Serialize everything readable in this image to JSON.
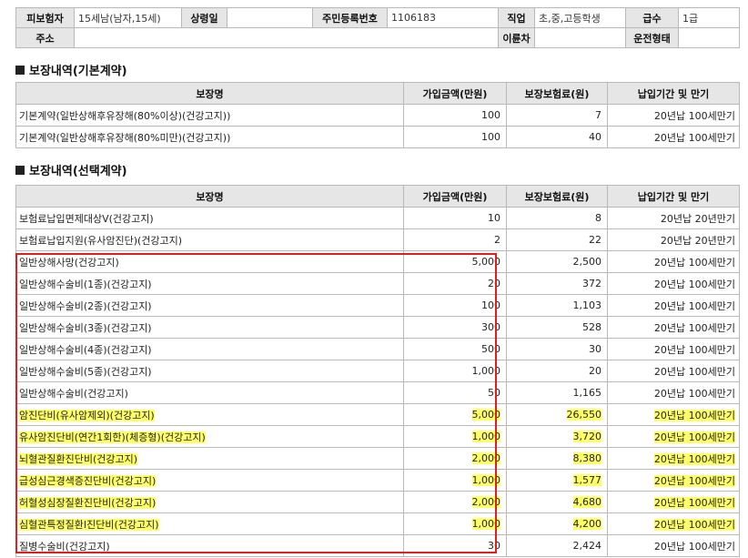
{
  "insured": {
    "label_insured": "피보험자",
    "insured_value": "15세남(남자,15세)",
    "label_date": "상령일",
    "date_value": "",
    "label_id": "주민등록번호",
    "id_value": "1106183",
    "label_job": "직업",
    "job_value": "초,중,고등학생",
    "label_grade": "급수",
    "grade_value": "1급",
    "label_address": "주소",
    "address_value": "",
    "label_two_wheel": "이륜차",
    "two_wheel_value": "",
    "label_drive": "운전형태",
    "drive_value": ""
  },
  "headers": {
    "name": "보장명",
    "amount": "가입금액(만원)",
    "premium": "보장보험료(원)",
    "term": "납입기간 및 만기"
  },
  "basic": {
    "title": "보장내역(기본계약)",
    "rows": [
      {
        "name": "기본계약(일반상해후유장해(80%이상)(건강고지))",
        "amount": "100",
        "premium": "7",
        "term": "20년납 100세만기"
      },
      {
        "name": "기본계약(일반상해후유장해(80%미만)(건강고지))",
        "amount": "100",
        "premium": "40",
        "term": "20년납 100세만기"
      }
    ]
  },
  "optional": {
    "title": "보장내역(선택계약)",
    "rows": [
      {
        "name": "보험료납입면제대상Ⅴ(건강고지)",
        "amount": "10",
        "premium": "8",
        "term": "20년납 20년만기",
        "highlight": false
      },
      {
        "name": "보험료납입지원(유사암진단)(건강고지)",
        "amount": "2",
        "premium": "22",
        "term": "20년납 20년만기",
        "highlight": false
      },
      {
        "name": "일반상해사망(건강고지)",
        "amount": "5,000",
        "premium": "2,500",
        "term": "20년납 100세만기",
        "highlight": false
      },
      {
        "name": "일반상해수술비(1종)(건강고지)",
        "amount": "20",
        "premium": "372",
        "term": "20년납 100세만기",
        "highlight": false
      },
      {
        "name": "일반상해수술비(2종)(건강고지)",
        "amount": "100",
        "premium": "1,103",
        "term": "20년납 100세만기",
        "highlight": false
      },
      {
        "name": "일반상해수술비(3종)(건강고지)",
        "amount": "300",
        "premium": "528",
        "term": "20년납 100세만기",
        "highlight": false
      },
      {
        "name": "일반상해수술비(4종)(건강고지)",
        "amount": "500",
        "premium": "30",
        "term": "20년납 100세만기",
        "highlight": false
      },
      {
        "name": "일반상해수술비(5종)(건강고지)",
        "amount": "1,000",
        "premium": "20",
        "term": "20년납 100세만기",
        "highlight": false
      },
      {
        "name": "일반상해수술비(건강고지)",
        "amount": "50",
        "premium": "1,165",
        "term": "20년납 100세만기",
        "highlight": false
      },
      {
        "name": "암진단비(유사암제외)(건강고지)",
        "amount": "5,000",
        "premium": "26,550",
        "term": "20년납 100세만기",
        "highlight": true
      },
      {
        "name": "유사암진단비(연간1회한)(체증형)(건강고지)",
        "amount": "1,000",
        "premium": "3,720",
        "term": "20년납 100세만기",
        "highlight": true
      },
      {
        "name": "뇌혈관질환진단비(건강고지)",
        "amount": "2,000",
        "premium": "8,380",
        "term": "20년납 100세만기",
        "highlight": true
      },
      {
        "name": "급성심근경색증진단비(건강고지)",
        "amount": "1,000",
        "premium": "1,577",
        "term": "20년납 100세만기",
        "highlight": true
      },
      {
        "name": "허혈성심장질환진단비(건강고지)",
        "amount": "2,000",
        "premium": "4,680",
        "term": "20년납 100세만기",
        "highlight": true
      },
      {
        "name": "심혈관특정질환Ⅰ진단비(건강고지)",
        "amount": "1,000",
        "premium": "4,200",
        "term": "20년납 100세만기",
        "highlight": true
      },
      {
        "name": "질병수술비(건강고지)",
        "amount": "30",
        "premium": "2,424",
        "term": "20년납 100세만기",
        "highlight": false
      }
    ]
  },
  "colors": {
    "header_bg": "#e6e6e6",
    "highlight": "#ffff66",
    "red_box": "#e02020"
  }
}
